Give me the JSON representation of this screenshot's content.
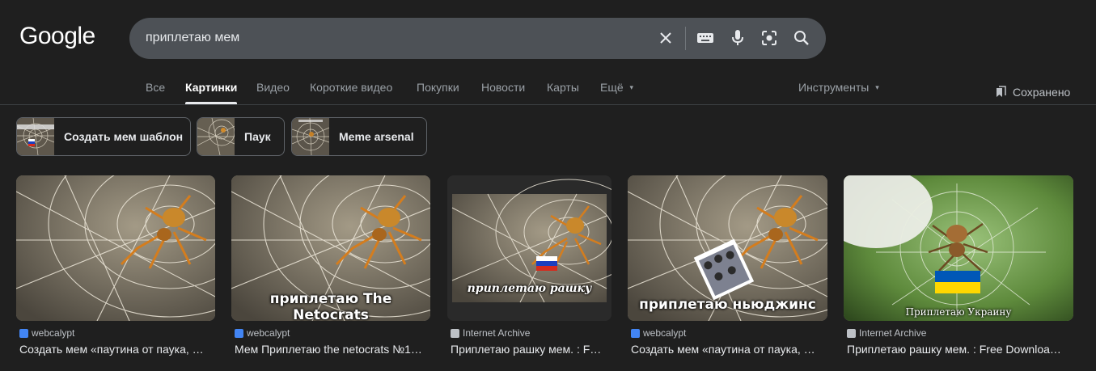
{
  "header": {
    "logo": "Google",
    "search": {
      "query": "приплетаю мем"
    }
  },
  "tabs": [
    {
      "label": "Все",
      "active": false
    },
    {
      "label": "Картинки",
      "active": true
    },
    {
      "label": "Видео",
      "active": false
    },
    {
      "label": "Короткие видео",
      "active": false
    },
    {
      "label": "Покупки",
      "active": false
    },
    {
      "label": "Новости",
      "active": false
    },
    {
      "label": "Карты",
      "active": false
    },
    {
      "label": "Ещё",
      "active": false
    }
  ],
  "tools_label": "Инструменты",
  "saved_label": "Сохранено",
  "chips": [
    {
      "label": "Создать мем шаблон"
    },
    {
      "label": "Паук"
    },
    {
      "label": "Meme arsenal"
    }
  ],
  "results": [
    {
      "source": "webcalypt",
      "title": "Создать мем «паутина от паука, …",
      "caption": ""
    },
    {
      "source": "webcalypt",
      "title": "Мем Приплетаю the netocrats №1…",
      "caption": "приплетаю The Netocrats"
    },
    {
      "source": "Internet Archive",
      "title": "Приплетаю рашку мем. : F…",
      "caption": "приплетаю рашку"
    },
    {
      "source": "webcalypt",
      "title": "Создать мем «паутина от паука, …",
      "caption": "приплетаю ньюджинс"
    },
    {
      "source": "Internet Archive",
      "title": "Приплетаю рашку мем. : Free Downloa…",
      "caption": "Приплетаю Украину"
    }
  ],
  "colors": {
    "background": "#1f1f1f",
    "search_box": "#4d5156",
    "favicon_blue": "#4285f4"
  }
}
